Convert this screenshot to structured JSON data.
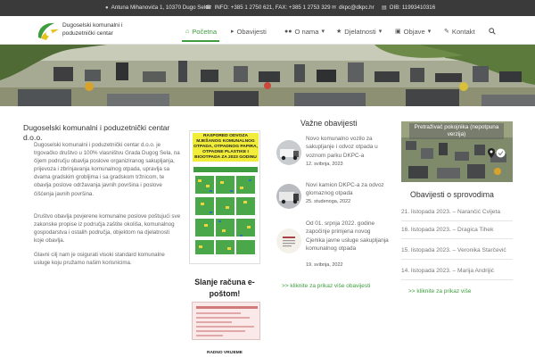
{
  "topbar": {
    "address": "Antuna Mihanovića 1, 10370 Dugo Selo",
    "phone_fax": "INFO: +385 1 2750 621, FAX: +385 1 2753 329",
    "email": "dkpc@dkpc.hr",
    "oib": "OIB: 11993410316",
    "icons": [
      "map-marker-icon",
      "phone-icon",
      "envelope-icon",
      "id-card-icon"
    ]
  },
  "brand": {
    "line1": "Dugoselski komunalni i",
    "line2": "poduzetnički centar",
    "colors": {
      "green": "#3f9d3f",
      "yellow": "#e7c21b",
      "dark": "#3a3a3a"
    }
  },
  "nav": {
    "items": [
      {
        "label": "Početna",
        "icon": "home-icon",
        "active": true
      },
      {
        "label": "Obavijesti",
        "icon": "megaphone-icon",
        "active": false
      },
      {
        "label": "O nama",
        "icon": "users-icon",
        "active": false,
        "has_menu": true
      },
      {
        "label": "Djelatnosti",
        "icon": "share-icon",
        "active": false,
        "has_menu": true
      },
      {
        "label": "Objave",
        "icon": "folder-icon",
        "active": false,
        "has_menu": true
      },
      {
        "label": "Kontakt",
        "icon": "edit-icon",
        "active": false
      }
    ],
    "search_icon": "search-icon"
  },
  "about": {
    "title": "Dugoselski komunalni i poduzetnički centar d.o.o.",
    "paragraphs": [
      "Dugoselski komunalni i poduzetnički centar d.o.o. je trgovačko društvo u 100% vlasništvu Grada Dugog Sela, na čijem području obavlja poslove organiziranog sakupljanja, prijevoza i zbrinjavanja komunalnog otpada, upravlja sa dvama gradskim grobljima i sa gradskom tržnicom, te obavlja poslove održavanja javnih površina i poslove čišćenja javnih površina.",
      "Društvo obavlja povjerene komunalne poslove poštujući sve zakonske propise iz područja zaštite okoliša, komunalnog gospodarstva i ostalih područja, objektom na djelatnosti koje obavlja.",
      "Glavni cilj nam je osigurati visoki standard komunalne usluge koju pružamo našim korisnicima."
    ]
  },
  "poster": {
    "title": "RASPORED ODVOZA MJEŠANOG KOMUNALNOG OTPADA, OTPADNOG PAPIRA, OTPADNE PLASTIKE I BIOOTPADA ZA 2023 GODINU"
  },
  "email_form": {
    "title": "Slanje računa e-poštom!"
  },
  "radno": "RADNO VRIJEME",
  "notices": {
    "title": "Važne obavijesti",
    "items": [
      {
        "text": "Novo komunalno vozilo za sakupljanje i odvoz otpada u voznom parku DKPC-a",
        "date": "12. svibnja, 2023"
      },
      {
        "text": "Novi kamion DKPC-a za odvoz glomaznog otpada",
        "date": "25. studenoga, 2022"
      },
      {
        "text": "Od 01. srpnja 2022. godine započinje primjena novog Cjenika javne usluge sakupljanja komunalnog otpada",
        "date": "19. svibnja, 2022"
      }
    ],
    "more": ">> kliknite za prikaz više obavijesti"
  },
  "cemetery": {
    "search_caption": "Pretraživač pokojnika (nepotpuna verzija)",
    "title": "Obavijesti o sprovodima",
    "items": [
      "21. listopada 2023. – Narančić Cvijeta",
      "16. listopada 2023. – Dragica Tihek",
      "15. listopada 2023. – Veronika Starčević",
      "14. listopada 2023. – Marija Andrijić"
    ],
    "more": ">> kliknite za prikaz više"
  }
}
